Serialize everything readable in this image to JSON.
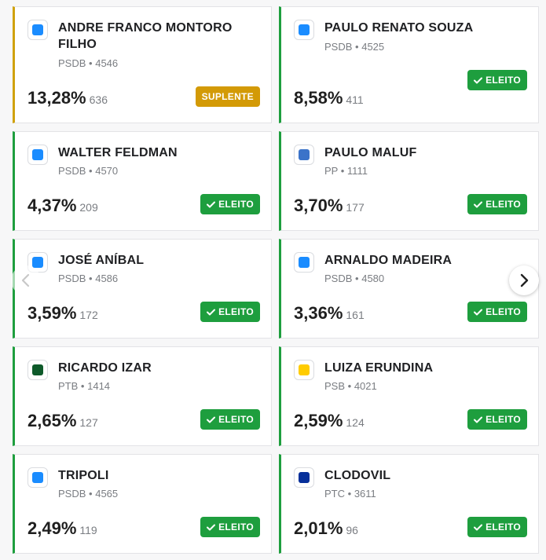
{
  "candidates": [
    {
      "name": "ANDRE FRANCO MONTORO FILHO",
      "party": "PSDB",
      "number": "4546",
      "percent": "13,28%",
      "votes": "636",
      "status": "SUPLENTE",
      "color": "#1a8cff"
    },
    {
      "name": "PAULO RENATO SOUZA",
      "party": "PSDB",
      "number": "4525",
      "percent": "8,58%",
      "votes": "411",
      "status": "ELEITO",
      "color": "#1a8cff"
    },
    {
      "name": "WALTER FELDMAN",
      "party": "PSDB",
      "number": "4570",
      "percent": "4,37%",
      "votes": "209",
      "status": "ELEITO",
      "color": "#1a8cff"
    },
    {
      "name": "PAULO MALUF",
      "party": "PP",
      "number": "1111",
      "percent": "3,70%",
      "votes": "177",
      "status": "ELEITO",
      "color": "#3b73c9"
    },
    {
      "name": "JOSÉ ANÍBAL",
      "party": "PSDB",
      "number": "4586",
      "percent": "3,59%",
      "votes": "172",
      "status": "ELEITO",
      "color": "#1a8cff"
    },
    {
      "name": "ARNALDO MADEIRA",
      "party": "PSDB",
      "number": "4580",
      "percent": "3,36%",
      "votes": "161",
      "status": "ELEITO",
      "color": "#1a8cff"
    },
    {
      "name": "RICARDO IZAR",
      "party": "PTB",
      "number": "1414",
      "percent": "2,65%",
      "votes": "127",
      "status": "ELEITO",
      "color": "#0e5a2a"
    },
    {
      "name": "LUIZA ERUNDINA",
      "party": "PSB",
      "number": "4021",
      "percent": "2,59%",
      "votes": "124",
      "status": "ELEITO",
      "color": "#ffcc00"
    },
    {
      "name": "TRIPOLI",
      "party": "PSDB",
      "number": "4565",
      "percent": "2,49%",
      "votes": "119",
      "status": "ELEITO",
      "color": "#1a8cff"
    },
    {
      "name": "CLODOVIL",
      "party": "PTC",
      "number": "3611",
      "percent": "2,01%",
      "votes": "96",
      "status": "ELEITO",
      "color": "#07309a"
    }
  ],
  "separator": "•",
  "icons": {
    "prev": "chevron-left-icon",
    "next": "chevron-right-icon",
    "check": "check-icon"
  }
}
